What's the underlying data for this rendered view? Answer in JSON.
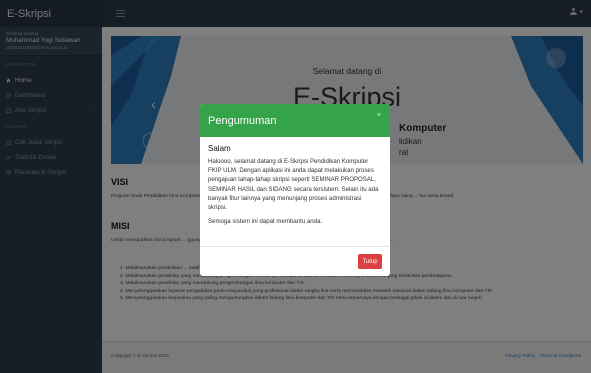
{
  "app": {
    "title": "E-Skripsi"
  },
  "topbar": {
    "user_caret": "▾"
  },
  "sidebar": {
    "welcome": "Selamat Datang",
    "user_name": "Muhammad Yogi Setiawan",
    "user_email": "1810131110005@mhs.ulm.ac.id",
    "section_navigation": "NAVIGATION",
    "section_lainnya": "LAINNYA",
    "items": [
      {
        "label": "Home",
        "icon": "home-icon"
      },
      {
        "label": "Dashboard",
        "icon": "dashboard-icon"
      },
      {
        "label": "Alur Skripsi",
        "icon": "list-icon"
      },
      {
        "label": "Cek Judul Skripsi",
        "icon": "clipboard-icon"
      },
      {
        "label": "Statistik Dosen",
        "icon": "chart-icon"
      },
      {
        "label": "Panduan E-Skripsi",
        "icon": "book-icon"
      }
    ]
  },
  "hero": {
    "greeting": "Selamat datang di",
    "title": "E-Skripsi",
    "line2": "Komputer",
    "line3": "lidikan",
    "line4": "rat"
  },
  "content": {
    "visi_title": "VISI",
    "visi_text": "Program Studi Pendidikan Ilmu Komputer ... ter dan TIK yang mampu menghasilkan tenaga pendidik dan kependidikan yang berdaya saing ... kur serta kreatif.",
    "misi_title": "MISI",
    "misi_intro": "Untuk mewujudkan visi program ... ggungjawab, dan adil, maka dirumuskan misi program studi Pendidikan Ilmu Komputer sebag...",
    "misi_items": [
      "1. Melaksanakan pendidikan ... ntatif.",
      "2. Melaksanakan penelitian yang mendukung pengembangan metode pembelajaran inovatif berbasis teknologi untukmenunjang efektivitas pembelajaran.",
      "3. Melaksanakan penelitian yang mendukung pengembangan ilmu komputer dan TIK.",
      "4. Menyelenggarakan layanan pengabdian pada masyarakat yang profesional dalam rangka ikut serta memecahkan masalah nasional dalam bidang ilmu komputer dan TIK.",
      "5. Menyelenggarakan kerjasama yang saling menguntungkan dalam bidang ilmu komputer dan TIK serta terpercaya dengan berbagai pihak di dalam dan di luar negeri."
    ]
  },
  "footer": {
    "copyright": "Copyright © E-Skripsi 2022",
    "links": "Privacy Policy · Terms & Conditions"
  },
  "modal": {
    "header": "Pengumuman",
    "close_symbol": "×",
    "title": "Salam",
    "text": "Haloooo, selamat datang di E-Skripsi Pendidikan Komputer FKIP ULM. Dengan aplikasi ini anda dapat melakukan proses pengajuan tahap-tahap skripsi seperti SEMINAR PROPOSAL, SEMINAR HASIL dan SIDANG secara tersistem. Selain itu ada banyak fitur lainnya yang menunjang proses administrasi skripsi.",
    "note": "Semoga sistem ini dapat membantu anda.",
    "button": "Tutup"
  },
  "colors": {
    "modal_header": "#35a34a",
    "close_button": "#dc3f3f",
    "sidebar": "#2f3d4f",
    "topbar": "#2d3a4b",
    "hero_accent": "#2f7fc1"
  }
}
